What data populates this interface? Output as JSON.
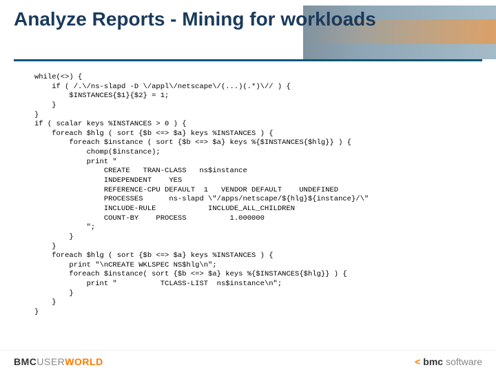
{
  "title": "Analyze Reports - Mining for workloads",
  "code": "while(<>) {\n    if ( /.\\/ns-slapd -D \\/appl\\/netscape\\/(...)(.*)\\// ) {\n        $INSTANCES{$1}{$2} = 1;\n    }\n}\nif ( scalar keys %INSTANCES > 0 ) {\n    foreach $hlg ( sort {$b <=> $a} keys %INSTANCES ) {\n        foreach $instance ( sort {$b <=> $a} keys %{$INSTANCES{$hlg}} ) {\n            chomp($instance);\n            print \"\n                CREATE   TRAN-CLASS   ns$instance\n                INDEPENDENT    YES\n                REFERENCE-CPU DEFAULT  1   VENDOR DEFAULT    UNDEFINED\n                PROCESSES      ns-slapd \\\"/apps/netscape/${hlg}${instance}/\\\"\n                INCLUDE-RULE            INCLUDE_ALL_CHILDREN\n                COUNT-BY    PROCESS          1.000000\n            \";\n        }\n    }\n    foreach $hlg ( sort {$b <=> $a} keys %INSTANCES ) {\n        print \"\\nCREATE WKLSPEC NS$hlg\\n\";\n        foreach $instance( sort {$b <=> $a} keys %{$INSTANCES{$hlg}} ) {\n            print \"          TCLASS-LIST  ns$instance\\n\";\n        }\n    }\n}",
  "footer": {
    "left_bmc": "BMC",
    "left_user": "USER",
    "left_world": "WORLD",
    "right_arrow": "<",
    "right_bmc": "bmc",
    "right_soft": "software"
  }
}
